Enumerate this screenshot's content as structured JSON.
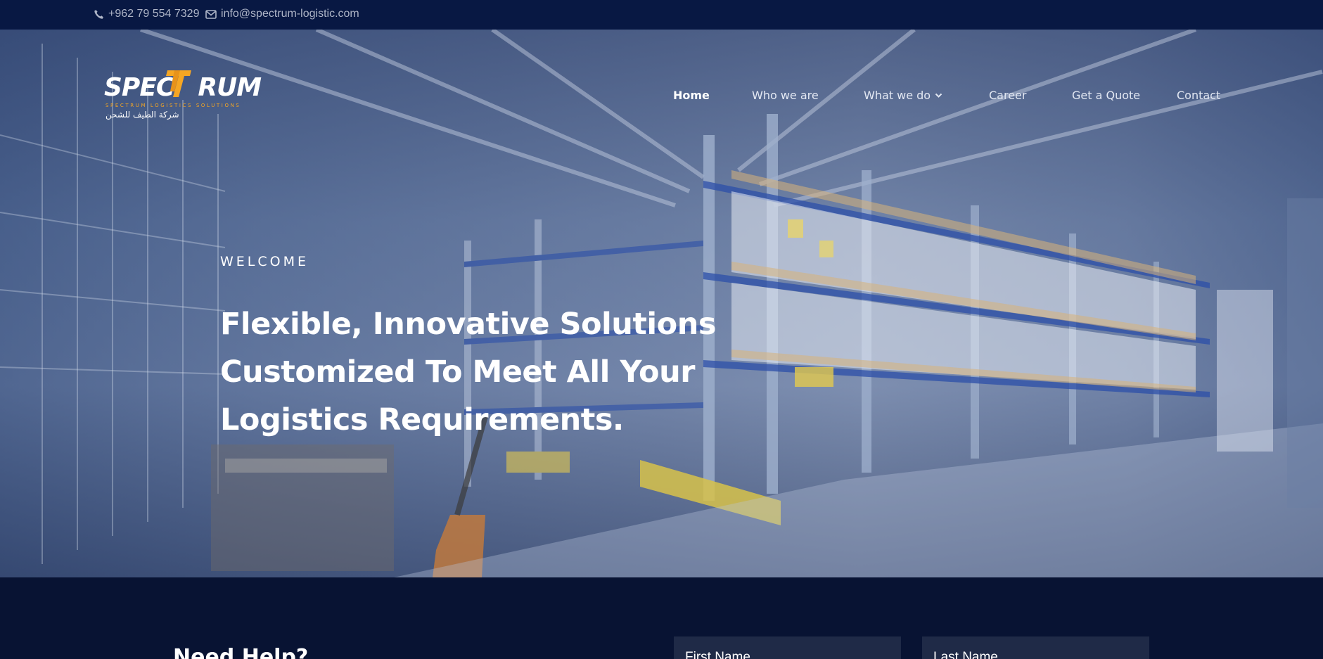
{
  "topbar": {
    "phone": "+962 79 554 7329",
    "email": "info@spectrum-logistic.com",
    "phone_icon": "phone-icon",
    "email_icon": "envelope-icon"
  },
  "logo": {
    "word_left": "SPEC",
    "word_right": "RUM",
    "tagline": "SPECTRUM LOGISTICS SOLUTIONS",
    "arabic": "شركة الطيف للشحن"
  },
  "nav": {
    "items": [
      {
        "label": "Home",
        "active": true
      },
      {
        "label": "Who we are"
      },
      {
        "label": "What we do",
        "dropdown": true
      },
      {
        "label": "Career"
      },
      {
        "label": "Get a Quote"
      },
      {
        "label": "Contact"
      }
    ]
  },
  "hero": {
    "eyebrow": "WELCOME",
    "line1": "Flexible, Innovative Solutions",
    "line2": "Customized To Meet All Your",
    "line3": "Logistics Requirements."
  },
  "help": {
    "title": "Need Help?",
    "first_name_placeholder": "First Name",
    "last_name_placeholder": "Last Name"
  },
  "colors": {
    "topbar_bg": "#081843",
    "brand_orange": "#f5a623",
    "section_bg": "#081333",
    "field_bg": "#1f2a47"
  }
}
